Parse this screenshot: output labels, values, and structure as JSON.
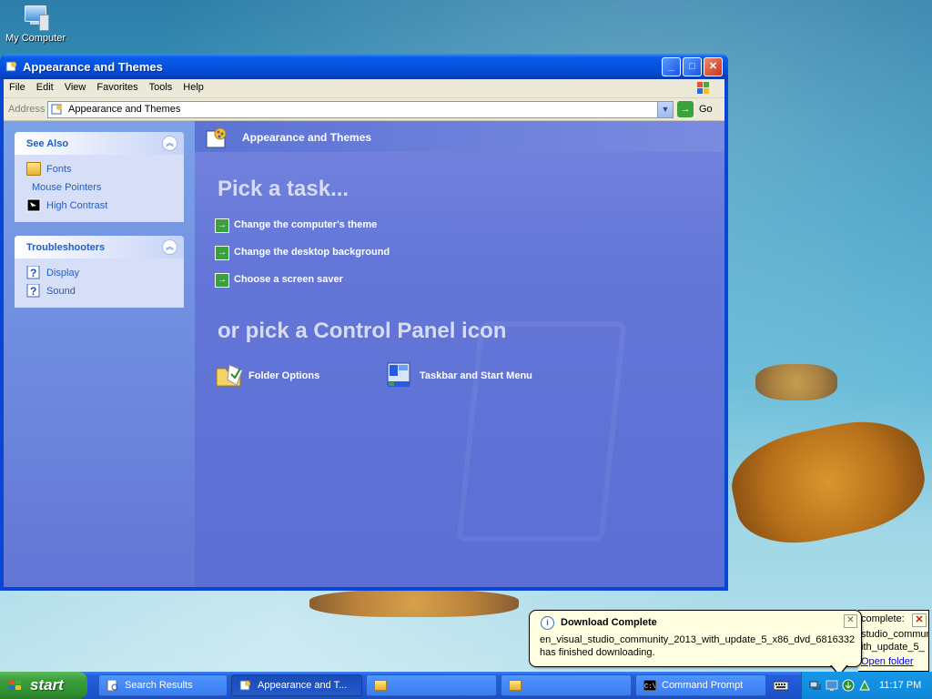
{
  "desktop": {
    "icons": [
      {
        "label": "My Computer",
        "icon": "my-computer-icon"
      }
    ]
  },
  "window": {
    "title": "Appearance and Themes",
    "controls": {
      "minimize": "_",
      "maximize": "□",
      "close": "✕"
    },
    "menu": [
      "File",
      "Edit",
      "View",
      "Favorites",
      "Tools",
      "Help"
    ],
    "address": {
      "label": "Address",
      "value": "Appearance and Themes",
      "go": "Go"
    },
    "see_also": {
      "title": "See Also",
      "items": [
        {
          "label": "Fonts",
          "icon": "fonts-folder-icon"
        },
        {
          "label": "Mouse Pointers",
          "icon": ""
        },
        {
          "label": "High Contrast",
          "icon": "high-contrast-icon"
        }
      ]
    },
    "troubleshooters": {
      "title": "Troubleshooters",
      "items": [
        {
          "label": "Display",
          "icon": "help-icon"
        },
        {
          "label": "Sound",
          "icon": "help-icon"
        }
      ]
    },
    "main": {
      "header": "Appearance and Themes",
      "pick_task": "Pick a task...",
      "tasks": [
        "Change the computer's theme",
        "Change the desktop background",
        "Choose a screen saver"
      ],
      "pick_icon": "or pick a Control Panel icon",
      "cp_icons": [
        {
          "label": "Folder Options",
          "icon": "folder-options-icon"
        },
        {
          "label": "Taskbar and Start Menu",
          "icon": "taskbar-start-menu-icon"
        }
      ]
    }
  },
  "balloon": {
    "title": "Download Complete",
    "message1": "en_visual_studio_community_2013_with_update_5_x86_dvd_6816332",
    "message2": "has finished downloading.",
    "close": "✕"
  },
  "balloon2": {
    "line1": "complete:",
    "line2": "studio_commun",
    "line3": "ith_update_5_",
    "link": "Open folder",
    "close": "✕"
  },
  "taskbar": {
    "start": "start",
    "items": [
      {
        "label": "Search Results",
        "active": false
      },
      {
        "label": "Appearance and T...",
        "active": true
      },
      {
        "label": "",
        "active": false
      },
      {
        "label": "",
        "active": false
      },
      {
        "label": "Command Prompt",
        "active": false
      }
    ],
    "clock": "11:17 PM"
  },
  "colors": {
    "accent": "#0a46d6",
    "start_green": "#3c9e3c",
    "link": "#215dc6"
  }
}
